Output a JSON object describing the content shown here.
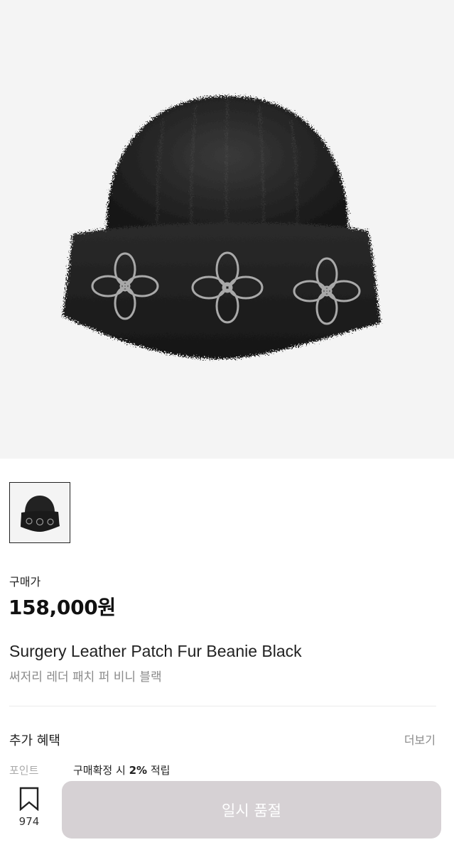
{
  "product": {
    "image_alt": "black fur beanie with leather flower patches",
    "price_label": "구매가",
    "price": "158,000원",
    "name_en": "Surgery Leather Patch Fur Beanie Black",
    "name_ko": "써저리 레더 패치 퍼 비니 블랙"
  },
  "benefits": {
    "title": "추가 혜택",
    "more_label": "더보기",
    "point_label": "포인트",
    "point_prefix": "구매확정 시",
    "point_rate": "2%",
    "point_suffix": "적립"
  },
  "bottom_bar": {
    "wish_count": "974",
    "buy_label": "일시 품절"
  },
  "colors": {
    "hero_bg": "#f4f4f4",
    "disabled_button": "#d6d1d4",
    "text_primary": "#222222",
    "text_secondary": "#8a8a8a"
  },
  "icons": {
    "wishlist": "bookmark-icon"
  }
}
